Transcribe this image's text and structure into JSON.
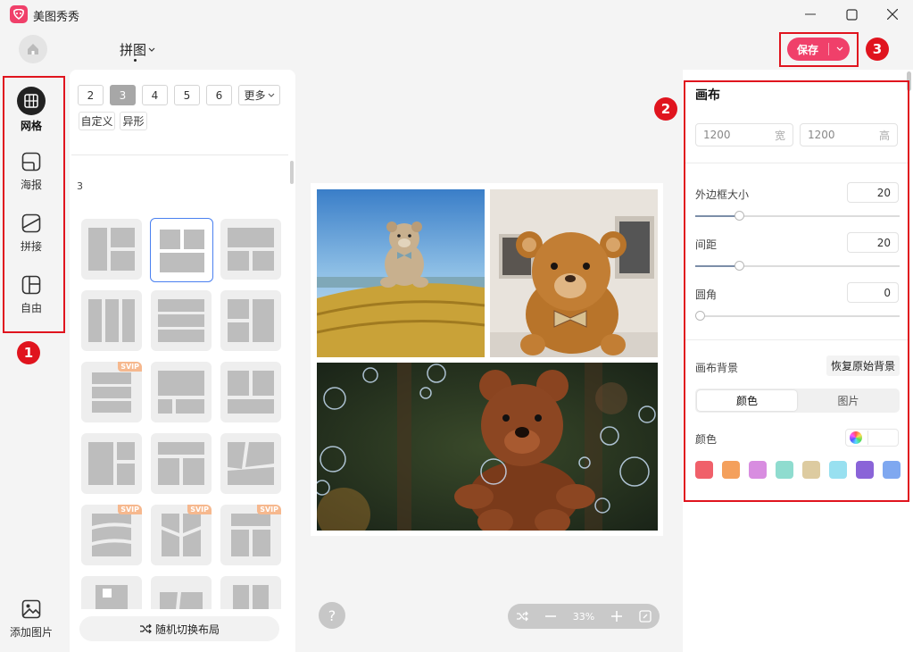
{
  "app": {
    "name": "美图秀秀"
  },
  "header": {
    "mode_title": "拼图",
    "save_label": "保存"
  },
  "left_nav": {
    "items": [
      {
        "label": "网格",
        "active": true
      },
      {
        "label": "海报",
        "active": false
      },
      {
        "label": "拼接",
        "active": false
      },
      {
        "label": "自由",
        "active": false
      }
    ],
    "add_image_label": "添加图片"
  },
  "layout_panel": {
    "counts": [
      "2",
      "3",
      "4",
      "5",
      "6"
    ],
    "selected_count": "3",
    "more_label": "更多",
    "custom_label": "自定义",
    "special_label": "异形",
    "section_label": "3",
    "svip_label": "SVIP",
    "shuffle_label": "随机切换布局"
  },
  "canvas": {
    "zoom": "33%",
    "help_icon": "?"
  },
  "settings": {
    "title": "画布",
    "width": "1200",
    "width_unit": "宽",
    "height": "1200",
    "height_unit": "高",
    "border_label": "外边框大小",
    "border_value": "20",
    "border_level": 20,
    "spacing_label": "间距",
    "spacing_value": "20",
    "spacing_level": 20,
    "corner_label": "圆角",
    "corner_value": "0",
    "corner_level": 0,
    "bg_label": "画布背景",
    "reset_bg_label": "恢复原始背景",
    "tab_color": "颜色",
    "tab_image": "图片",
    "color_label": "颜色",
    "swatches": [
      "#f0606a",
      "#f4a05c",
      "#d88de0",
      "#8fdccf",
      "#ddcba0",
      "#98e0f0",
      "#8a64d8",
      "#7fa8f0"
    ]
  },
  "annotations": {
    "badge1": "1",
    "badge2": "2",
    "badge3": "3"
  },
  "colors": {
    "accent": "#f0406a",
    "annotation_red": "#e0141e"
  }
}
